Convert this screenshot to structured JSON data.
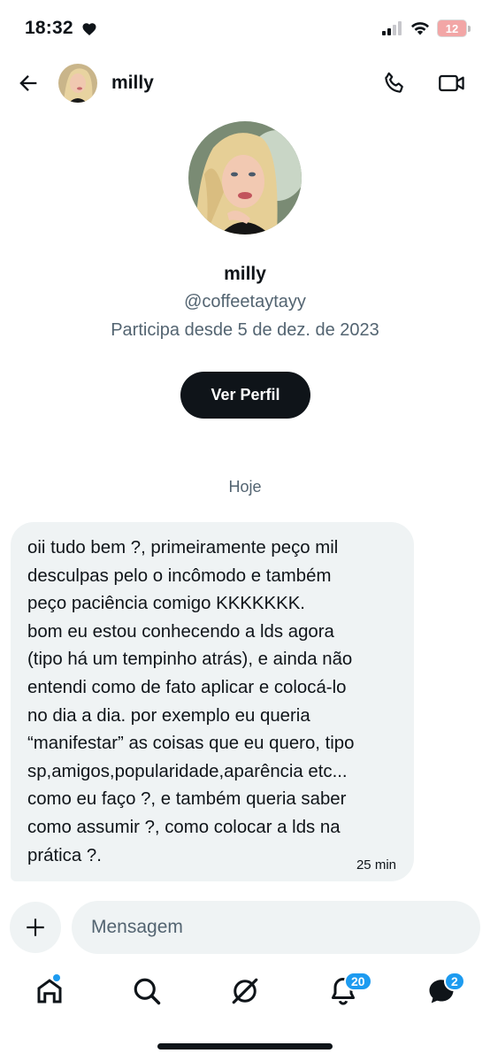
{
  "status_bar": {
    "time": "18:32",
    "battery": "12",
    "icons": [
      "heart-icon",
      "signal-icon",
      "wifi-icon",
      "battery-icon"
    ]
  },
  "header": {
    "name": "milly",
    "icons": [
      "back-arrow-icon",
      "phone-icon",
      "video-camera-icon"
    ]
  },
  "profile": {
    "name": "milly",
    "handle": "@coffeetaytayy",
    "joined": "Participa desde 5 de dez. de 2023",
    "view_profile_label": "Ver Perfil"
  },
  "conversation": {
    "day_label": "Hoje",
    "messages": [
      {
        "text": "oii tudo bem ?, primeiramente peço mil\ndesculpas pelo o incômodo e também\npeço paciência comigo KKKKKKK.\nbom eu estou conhecendo a lds agora\n(tipo há um tempinho atrás), e ainda não\nentendi como de fato aplicar e colocá-lo\nno dia a dia. por exemplo eu queria\n“manifestar” as coisas que eu quero, tipo\nsp,amigos,popularidade,aparência etc...\ncomo eu faço ?, e também queria saber\ncomo assumir ?, como colocar a lds na\nprática ?.",
        "time": "25 min"
      }
    ]
  },
  "composer": {
    "placeholder": "Mensagem"
  },
  "bottom_nav": {
    "notifications_badge": "20",
    "messages_badge": "2",
    "icons": [
      "home-icon",
      "search-icon",
      "grok-icon",
      "bell-icon",
      "messages-icon"
    ]
  },
  "colors": {
    "text_primary": "#0f1419",
    "text_secondary": "#536471",
    "bubble_bg": "#eff3f4",
    "accent": "#1d9bf0"
  }
}
